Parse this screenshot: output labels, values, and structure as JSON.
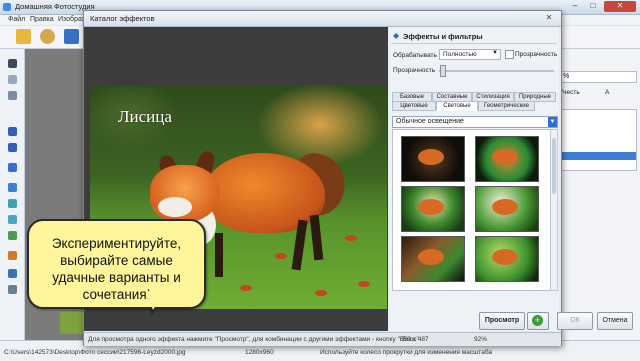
{
  "app": {
    "title": "Домашняя Фотостудия",
    "menu": [
      "Файл",
      "Правка",
      "Изображ"
    ],
    "right_panel": {
      "field_value": "%",
      "label_left": "Учесть",
      "label_right": "А"
    },
    "status": {
      "path": "C:\\Users\\142573\\Desktop\\Фото сессии\\217596-Leyzd2000.jpg",
      "dimensions": "1280x960",
      "hint": "Используйте колесо прокрутки для изменения масштаба"
    }
  },
  "dialog": {
    "title": "Каталог эффектов",
    "photo_caption": "Лисица",
    "bubble_text": "Экспериментируйте, выбирайте самые удачные варианты и сочетания!",
    "panel_header": "Эффекты и фильтры",
    "process_label": "Обрабатывать",
    "process_value": "Полностью",
    "transparency_check_label": "Прозрачность",
    "opacity_label": "Прозрачность",
    "opacity_fraction": 0,
    "tabs_row1": [
      "Базовые",
      "Составные",
      "Стилизация",
      "Природные"
    ],
    "tabs_row2": [
      "Цветовые",
      "Световые",
      "Геометрические"
    ],
    "active_tab": "Световые",
    "category_value": "Обычное освещение",
    "buttons": {
      "preview": "Просмотр",
      "add": "+",
      "ok": "ОК",
      "cancel": "Отмена"
    },
    "status": {
      "hint": "Для просмотра одного эффекта нажмите \"Просмотр\", для комбинации с другими эффектами - кнопку \"Плюс\"",
      "size": "650 x 487",
      "zoom": "92%"
    }
  },
  "colors": {
    "accent": "#2f6fd0",
    "bubble": "#fff59a",
    "close": "#c9463d",
    "add": "#3c9a3b"
  }
}
